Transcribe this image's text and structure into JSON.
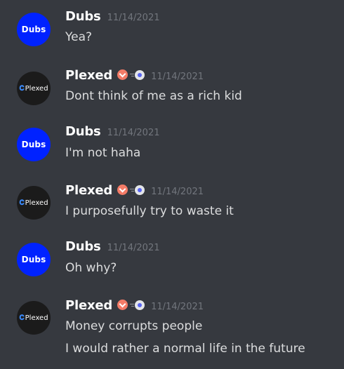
{
  "messages": [
    {
      "author": "Dubs",
      "avatar_text": "Dubs",
      "timestamp": "11/14/2021",
      "lines": [
        "Yea?"
      ]
    },
    {
      "author": "Plexed",
      "avatar_text": "Plexed",
      "timestamp": "11/14/2021",
      "lines": [
        "Dont think of me as a rich kid"
      ]
    },
    {
      "author": "Dubs",
      "avatar_text": "Dubs",
      "timestamp": "11/14/2021",
      "lines": [
        "I'm not haha"
      ]
    },
    {
      "author": "Plexed",
      "avatar_text": "Plexed",
      "timestamp": "11/14/2021",
      "lines": [
        "I purposefully try to waste it"
      ]
    },
    {
      "author": "Dubs",
      "avatar_text": "Dubs",
      "timestamp": "11/14/2021",
      "lines": [
        "Oh why?"
      ]
    },
    {
      "author": "Plexed",
      "avatar_text": "Plexed",
      "timestamp": "11/14/2021",
      "lines": [
        "Money corrupts people",
        "I would rather a normal life in the future"
      ]
    }
  ],
  "colors": {
    "background": "#36393f",
    "dubs_avatar": "#0022ff",
    "plexed_avatar": "#1b1b1b",
    "badge": "#f47b67",
    "boost_accent": "#5865f2",
    "timestamp": "#72767d",
    "message_text": "#dcddde"
  },
  "icons": {
    "badge": "verified-check-icon",
    "boost": "nitro-boost-icon",
    "plexed_logo": "plexed-logo-icon"
  }
}
